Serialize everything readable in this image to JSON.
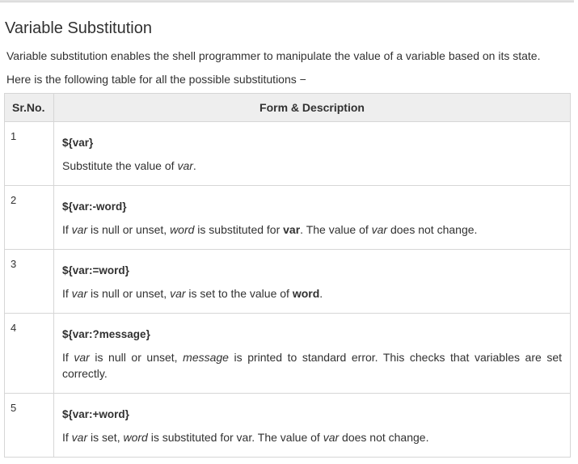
{
  "heading": "Variable Substitution",
  "intro": [
    "Variable substitution enables the shell programmer to manipulate the value of a variable based on its state.",
    "Here is the following table for all the possible substitutions −"
  ],
  "table": {
    "headers": [
      "Sr.No.",
      "Form & Description"
    ],
    "rows": [
      {
        "no": "1",
        "form": "${var}",
        "desc": [
          {
            "t": "Substitute the value of "
          },
          {
            "t": "var",
            "s": "i"
          },
          {
            "t": "."
          }
        ]
      },
      {
        "no": "2",
        "form": "${var:-word}",
        "desc": [
          {
            "t": "If "
          },
          {
            "t": "var",
            "s": "i"
          },
          {
            "t": " is null or unset, "
          },
          {
            "t": "word",
            "s": "i"
          },
          {
            "t": " is substituted for "
          },
          {
            "t": "var",
            "s": "b"
          },
          {
            "t": ". The value of "
          },
          {
            "t": "var",
            "s": "i"
          },
          {
            "t": " does not change."
          }
        ]
      },
      {
        "no": "3",
        "form": "${var:=word}",
        "desc": [
          {
            "t": "If "
          },
          {
            "t": "var",
            "s": "i"
          },
          {
            "t": " is null or unset, "
          },
          {
            "t": "var",
            "s": "i"
          },
          {
            "t": " is set to the value of "
          },
          {
            "t": "word",
            "s": "b"
          },
          {
            "t": "."
          }
        ]
      },
      {
        "no": "4",
        "form": "${var:?message}",
        "desc": [
          {
            "t": "If "
          },
          {
            "t": "var",
            "s": "i"
          },
          {
            "t": " is null or unset, "
          },
          {
            "t": "message",
            "s": "i"
          },
          {
            "t": " is printed to standard error. This checks that variables are set correctly."
          }
        ]
      },
      {
        "no": "5",
        "form": "${var:+word}",
        "desc": [
          {
            "t": "If "
          },
          {
            "t": "var",
            "s": "i"
          },
          {
            "t": " is set, "
          },
          {
            "t": "word",
            "s": "i"
          },
          {
            "t": " is substituted for var. The value of "
          },
          {
            "t": "var",
            "s": "i"
          },
          {
            "t": " does not change."
          }
        ]
      }
    ]
  }
}
